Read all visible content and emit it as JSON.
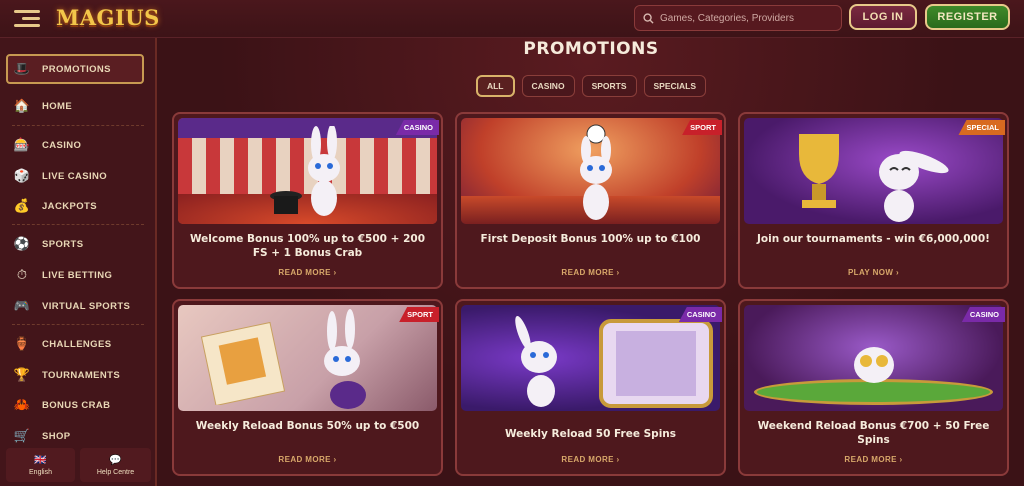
{
  "header": {
    "logo": "MAGIUS",
    "search_placeholder": "Games, Categories, Providers",
    "login": "LOG IN",
    "register": "REGISTER"
  },
  "sidebar": {
    "items": [
      {
        "label": "PROMOTIONS",
        "icon": "promotions-icon"
      },
      {
        "label": "HOME",
        "icon": "home-icon"
      },
      {
        "label": "CASINO",
        "icon": "casino-icon"
      },
      {
        "label": "LIVE CASINO",
        "icon": "live-casino-icon"
      },
      {
        "label": "JACKPOTS",
        "icon": "jackpots-icon"
      },
      {
        "label": "SPORTS",
        "icon": "sports-icon"
      },
      {
        "label": "LIVE BETTING",
        "icon": "live-betting-icon"
      },
      {
        "label": "VIRTUAL SPORTS",
        "icon": "virtual-sports-icon"
      },
      {
        "label": "CHALLENGES",
        "icon": "challenges-icon"
      },
      {
        "label": "TOURNAMENTS",
        "icon": "tournaments-icon"
      },
      {
        "label": "BONUS CRAB",
        "icon": "bonus-crab-icon"
      },
      {
        "label": "SHOP",
        "icon": "shop-icon"
      }
    ],
    "language": "English",
    "help": "Help Centre"
  },
  "main": {
    "title": "PROMOTIONS",
    "filters": [
      "ALL",
      "CASINO",
      "SPORTS",
      "SPECIALS"
    ],
    "active_filter": "ALL",
    "cards": [
      {
        "badge": "CASINO",
        "title": "Welcome Bonus 100% up to €500 + 200 FS + 1 Bonus Crab",
        "cta": "READ MORE"
      },
      {
        "badge": "SPORT",
        "title": "First Deposit Bonus 100% up to €100",
        "cta": "READ MORE"
      },
      {
        "badge": "SPECIAL",
        "title": "Join our tournaments - win €6,000,000!",
        "cta": "PLAY NOW"
      },
      {
        "badge": "SPORT",
        "title": "Weekly Reload Bonus 50% up to €500",
        "cta": "READ MORE"
      },
      {
        "badge": "CASINO",
        "title": "Weekly Reload 50 Free Spins",
        "cta": "READ MORE"
      },
      {
        "badge": "CASINO",
        "title": "Weekend Reload Bonus €700 + 50 Free Spins",
        "cta": "READ MORE"
      }
    ]
  },
  "colors": {
    "background": "#3a1216",
    "accent_gold": "#e8c98a",
    "register_green": "#3f8a2a",
    "casino_badge": "#7a2aa8",
    "sport_badge": "#c8202a",
    "special_badge": "#d86a20"
  }
}
